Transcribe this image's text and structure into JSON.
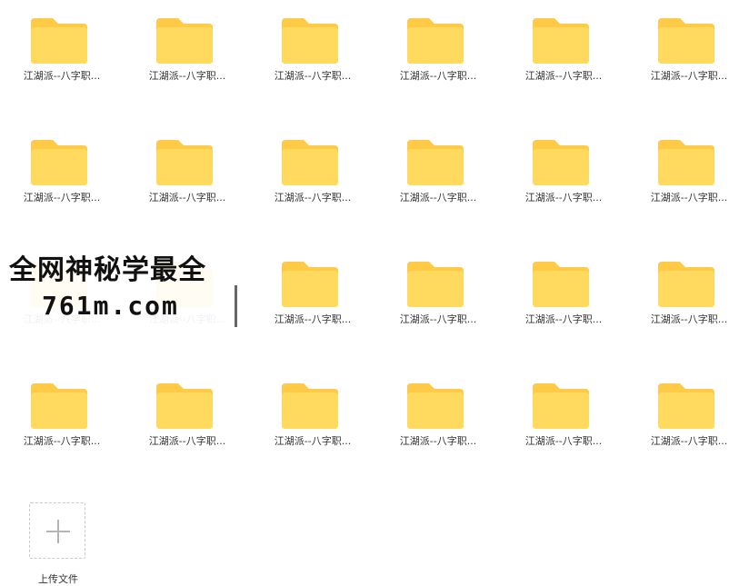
{
  "files": [
    {
      "name": "江湖派--八字职..."
    },
    {
      "name": "江湖派--八字职..."
    },
    {
      "name": "江湖派--八字职..."
    },
    {
      "name": "江湖派--八字职..."
    },
    {
      "name": "江湖派--八字职..."
    },
    {
      "name": "江湖派--八字职..."
    },
    {
      "name": "江湖派--八字职..."
    },
    {
      "name": "江湖派--八字职..."
    },
    {
      "name": "江湖派--八字职..."
    },
    {
      "name": "江湖派--八字职..."
    },
    {
      "name": "江湖派--八字职..."
    },
    {
      "name": "江湖派--八字职..."
    },
    {
      "name": "江湖派--八字职..."
    },
    {
      "name": "江湖派--八字职..."
    },
    {
      "name": "江湖派--八字职..."
    },
    {
      "name": "江湖派--八字职..."
    },
    {
      "name": "江湖派--八字职..."
    },
    {
      "name": "江湖派--八字职..."
    },
    {
      "name": "江湖派--八字职..."
    },
    {
      "name": "江湖派--八字职..."
    },
    {
      "name": "江湖派--八字职..."
    },
    {
      "name": "江湖派--八字职..."
    },
    {
      "name": "江湖派--八字职..."
    },
    {
      "name": "江湖派--八字职..."
    }
  ],
  "upload": {
    "label": "上传文件",
    "icon": "plus-icon"
  },
  "watermark": {
    "line1": "全网神秘学最全",
    "line2": "761m.com"
  },
  "colors": {
    "folder_back": "#FFCA45",
    "folder_front": "#FFDA5E",
    "label_text": "#333333",
    "upload_border": "#C9C9C9",
    "plus": "#B5B5B5"
  },
  "icons": {
    "file_tile": "folder-icon"
  }
}
